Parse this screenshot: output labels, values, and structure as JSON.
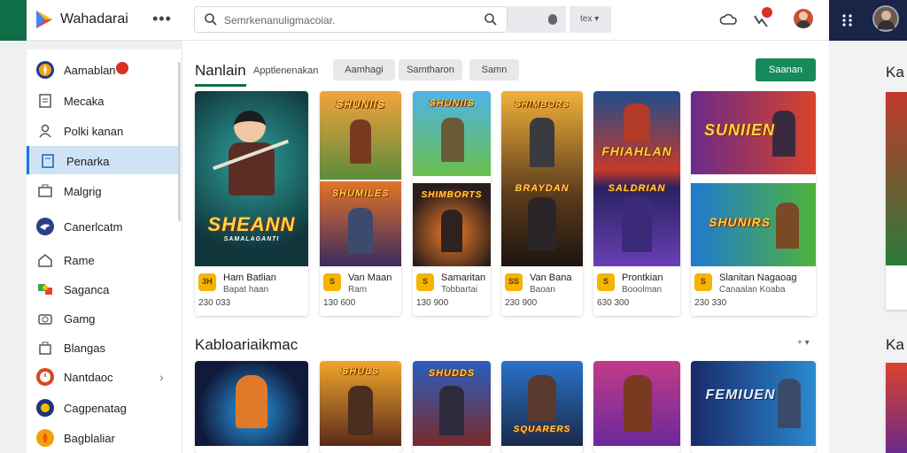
{
  "app": {
    "name": "Wahadarai"
  },
  "search": {
    "placeholder": "Semrkenanuligmacoiar."
  },
  "filter": {
    "label": "tex ▾"
  },
  "sidebar": {
    "items": [
      {
        "label": "Aamablan",
        "icon": "compass-icon"
      },
      {
        "label": "Mecaka",
        "icon": "document-icon"
      },
      {
        "label": "Polki kanan",
        "icon": "person-icon"
      },
      {
        "label": "Penarka",
        "icon": "bookmark-icon"
      },
      {
        "label": "Malgrig",
        "icon": "briefcase-icon"
      },
      {
        "label": "Canerlcatm",
        "icon": "bird-icon"
      },
      {
        "label": "Rame",
        "icon": "home-icon"
      },
      {
        "label": "Saganca",
        "icon": "puzzle-icon"
      },
      {
        "label": "Gamg",
        "icon": "camera-icon"
      },
      {
        "label": "Blangas",
        "icon": "bag-icon"
      },
      {
        "label": "Nantdaoc",
        "icon": "clock-icon"
      },
      {
        "label": "Cagpenatag",
        "icon": "globe-icon"
      },
      {
        "label": "Bagblaliar",
        "icon": "fire-icon"
      }
    ]
  },
  "section1": {
    "title": "Nanlain",
    "subtitle": "Apptlenenakan",
    "chips": [
      "Aamhagi",
      "Samtharon",
      "Samn"
    ],
    "action": "Saanan"
  },
  "cards_row1": [
    {
      "art_title": "SHEANN",
      "art_sub": "SAMALAGANTI",
      "icon_text": "3H",
      "name": "Ham Batlian",
      "sub": "Bapat haan",
      "count": "230 033"
    },
    {
      "art_title": "SHUNIIS",
      "art_title2": "SHUMILES",
      "icon_text": "S",
      "name": "Van Maan",
      "sub": "Ram",
      "count": "130 600"
    },
    {
      "art_title": "SHUNIIS",
      "art_title2": "SHIMBORTS",
      "icon_text": "S",
      "name": "Samaritan",
      "sub": "Tobbartai",
      "count": "130 900"
    },
    {
      "art_title": "SHIMBORS",
      "art_title2": "BRAYDAN",
      "icon_text": "SS",
      "name": "Van Bana",
      "sub": "Baoan",
      "count": "230 900"
    },
    {
      "art_title": "FHIAHLAN",
      "art_title2": "SALDRIAN",
      "icon_text": "S",
      "name": "Prontkian",
      "sub": "Booolman",
      "count": "630 300"
    },
    {
      "art_title": "SUNIIEN",
      "art_title2": "SHUNIRS",
      "icon_text": "S",
      "name": "Slanitan Nagaoag",
      "sub": "Canaalan Koaba",
      "count": "230 330"
    }
  ],
  "section2": {
    "title": "Kabloariaikmac",
    "more": "+ ▾"
  },
  "cards_row2": [
    {
      "art_title": ""
    },
    {
      "art_title": "SHULS"
    },
    {
      "art_title": "SHUDDS"
    },
    {
      "art_title": "SQUARERS"
    },
    {
      "art_title": ""
    },
    {
      "art_title": "FEMIUEN"
    }
  ],
  "right_partial": {
    "title1": "Ka",
    "title2": "Ka"
  },
  "colors": {
    "brand_green": "#0f6e47",
    "action_green": "#168a5a",
    "active_blue": "#cfe3f5",
    "header_dark": "#1a2447",
    "badge_red": "#d93025"
  }
}
